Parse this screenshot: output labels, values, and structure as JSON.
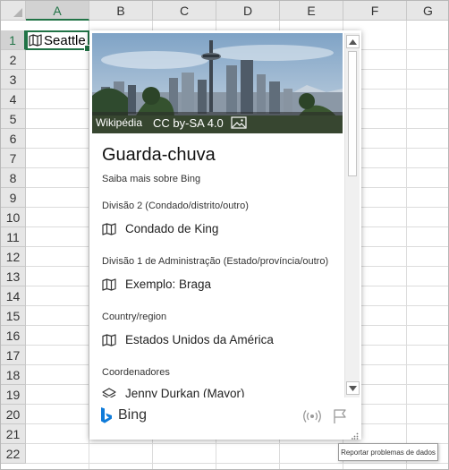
{
  "sheet": {
    "columns": [
      "A",
      "B",
      "C",
      "D",
      "E",
      "F",
      "G"
    ],
    "rows": [
      "1",
      "2",
      "3",
      "4",
      "5",
      "6",
      "7",
      "8",
      "9",
      "10",
      "11",
      "12",
      "13",
      "14",
      "15",
      "16",
      "17",
      "18",
      "19",
      "20",
      "21",
      "22"
    ],
    "active_cell_value": "Seattle",
    "active_cell_icon": "map-icon",
    "selection_color": "#217346"
  },
  "card": {
    "image_source": "Wikipédia",
    "image_license": "CC by-SA 4.0",
    "title": "Guarda-chuva",
    "subtitle": "Saiba mais sobre Bing",
    "fields": [
      {
        "label": "Divisão 2 (Condado/distrito/outro)",
        "value": "Condado de King",
        "icon": "map-icon"
      },
      {
        "label": "Divisão 1 de Administração (Estado/província/outro)",
        "value": "Exemplo: Braga",
        "icon": "map-icon"
      },
      {
        "label": "Country/region",
        "value": "Estados Unidos da América",
        "icon": "map-icon"
      },
      {
        "label": "Coordenadores",
        "value": "Jenny Durkan (Mayor)",
        "icon": "layers-icon"
      }
    ],
    "footer": {
      "brand": "Bing",
      "brand_icon": "bing-logo-icon",
      "brand_color": "#0f7bd9",
      "icons": [
        "broadcast-icon",
        "flag-icon"
      ]
    },
    "tooltip": "Reportar problemas de dados"
  }
}
